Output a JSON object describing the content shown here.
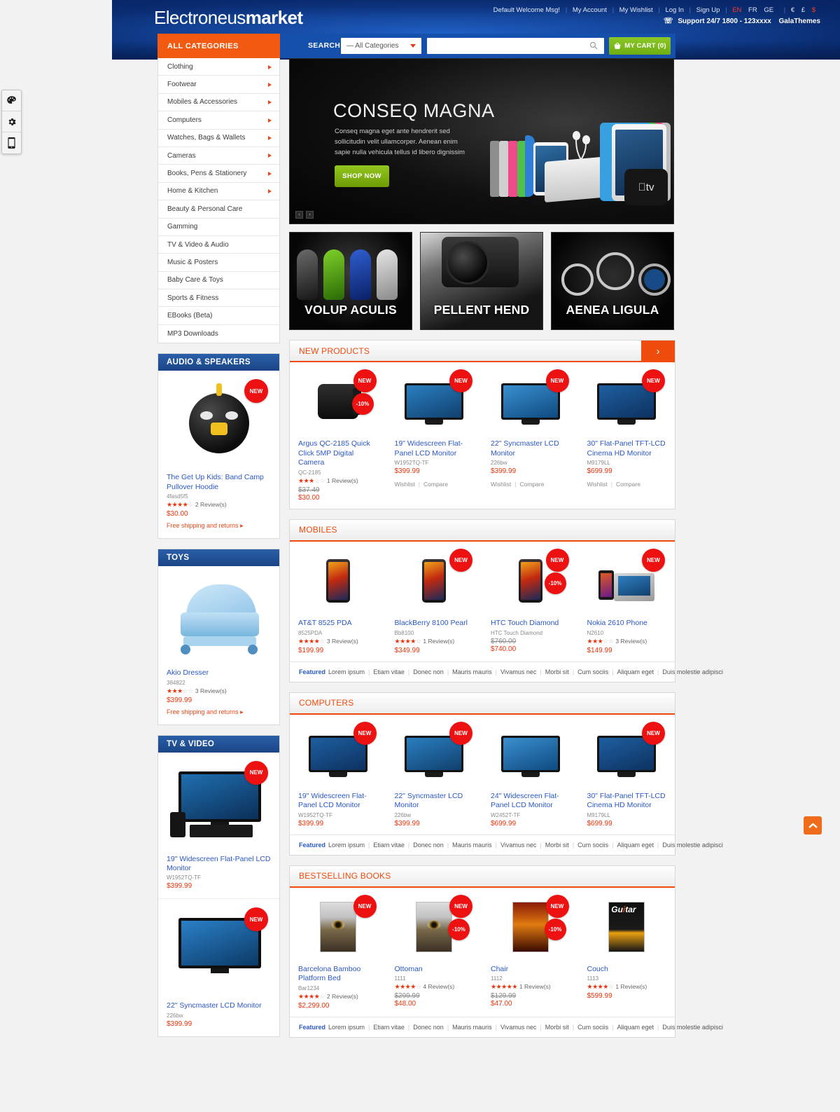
{
  "header": {
    "logo_light": "Electroneus",
    "logo_bold": "market",
    "toplinks": [
      "Default Welcome Msg!",
      "My Account",
      "My Wishlist",
      "Log In",
      "Sign Up"
    ],
    "languages": [
      "EN",
      "FR",
      "GE"
    ],
    "active_language": "EN",
    "currencies": [
      "€",
      "£",
      "$"
    ],
    "active_currency": "$",
    "support": "Support 24/7 1800 - 123xxxx",
    "brand": "GalaThemes",
    "phone_icon": "phone-icon"
  },
  "search": {
    "all_categories_tab": "ALL CATEGORIES",
    "label": "SEARCH:",
    "category_value": "— All Categories",
    "input_value": "",
    "placeholder": "",
    "cart_label": "MY CART (0)",
    "cart_count": 0
  },
  "categories": [
    {
      "label": "Clothing",
      "has_arrow": true
    },
    {
      "label": "Footwear",
      "has_arrow": true
    },
    {
      "label": "Mobiles & Accessories",
      "has_arrow": true
    },
    {
      "label": "Computers",
      "has_arrow": true
    },
    {
      "label": "Watches, Bags & Wallets",
      "has_arrow": true
    },
    {
      "label": "Cameras",
      "has_arrow": true
    },
    {
      "label": "Books, Pens & Stationery",
      "has_arrow": true
    },
    {
      "label": "Home & Kitchen",
      "has_arrow": true
    },
    {
      "label": "Beauty & Personal Care",
      "has_arrow": false
    },
    {
      "label": "Gamming",
      "has_arrow": false
    },
    {
      "label": "TV & Video & Audio",
      "has_arrow": false
    },
    {
      "label": "Music & Posters",
      "has_arrow": false
    },
    {
      "label": "Baby Care & Toys",
      "has_arrow": false
    },
    {
      "label": "Sports & Fitness",
      "has_arrow": false
    },
    {
      "label": "EBooks (Beta)",
      "has_arrow": false
    },
    {
      "label": "MP3 Downloads",
      "has_arrow": false
    }
  ],
  "hero": {
    "title": "CONSEQ MAGNA",
    "desc": "Conseq magna eget ante hendrerit sed sollicitudin velit ullamcorper. Aenean enim sapie nulla vehicula tellus id libero dignissim",
    "button": "SHOP NOW",
    "prev": "‹",
    "next": "›"
  },
  "promos": [
    {
      "label": "VOLUP ACULIS"
    },
    {
      "label": "PELLENT HEND"
    },
    {
      "label": "AENEA LIGULA"
    }
  ],
  "sidebar_widgets": [
    {
      "title": "AUDIO & SPEAKERS",
      "products": [
        {
          "name": "The Get Up Kids: Band Camp Pullover Hoodie",
          "sku": "4fasd5f5",
          "rating": 3.5,
          "reviews": "2 Review(s)",
          "price": "$30.00",
          "old_price": "",
          "badge_new": "NEW",
          "badge_off": "",
          "free_shipping": "Free shipping and returns"
        }
      ]
    },
    {
      "title": "TOYS",
      "products": [
        {
          "name": "Akio Dresser",
          "sku": "384822",
          "rating": 3,
          "reviews": "3 Review(s)",
          "price": "$399.99",
          "old_price": "",
          "badge_new": "",
          "badge_off": "",
          "free_shipping": "Free shipping and returns"
        }
      ]
    },
    {
      "title": "TV & VIDEO",
      "products": [
        {
          "name": "19\" Widescreen Flat-Panel LCD Monitor",
          "sku": "W1952TQ-TF",
          "rating": 0,
          "reviews": "",
          "price": "$399.99",
          "old_price": "",
          "badge_new": "NEW",
          "badge_off": "",
          "free_shipping": ""
        },
        {
          "name": "22\" Syncmaster LCD Monitor",
          "sku": "226bw",
          "rating": 0,
          "reviews": "",
          "price": "$399.99",
          "old_price": "",
          "badge_new": "NEW",
          "badge_off": "",
          "free_shipping": ""
        }
      ]
    }
  ],
  "sections": [
    {
      "title": "NEW PRODUCTS",
      "has_arrow": true,
      "arrow_glyph": "›",
      "footer": null,
      "products": [
        {
          "name": "Argus QC-2185 Quick Click 5MP Digital Camera",
          "sku": "QC-2185",
          "rating": 3,
          "reviews": "1 Review(s)",
          "old_price": "$37.49",
          "price": "$30.00",
          "badge_new": "NEW",
          "badge_off": "-10%",
          "wishlist": "",
          "compare": ""
        },
        {
          "name": "19\" Widescreen Flat-Panel LCD Monitor",
          "sku": "W1952TQ-TF",
          "rating": 0,
          "reviews": "",
          "old_price": "",
          "price": "$399.99",
          "badge_new": "NEW",
          "badge_off": "",
          "wishlist": "Wishlist",
          "compare": "Compare"
        },
        {
          "name": "22\" Syncmaster LCD Monitor",
          "sku": "226bw",
          "rating": 0,
          "reviews": "",
          "old_price": "",
          "price": "$399.99",
          "badge_new": "NEW",
          "badge_off": "",
          "wishlist": "Wishlist",
          "compare": "Compare"
        },
        {
          "name": "30\" Flat-Panel TFT-LCD Cinema HD Monitor",
          "sku": "M9179LL",
          "rating": 0,
          "reviews": "",
          "old_price": "",
          "price": "$699.99",
          "badge_new": "NEW",
          "badge_off": "",
          "wishlist": "Wishlist",
          "compare": "Compare"
        }
      ]
    },
    {
      "title": "MOBILES",
      "has_arrow": false,
      "arrow_glyph": "",
      "footer": {
        "active": "Featured",
        "items": [
          "Lorem ipsum",
          "Etiam vitae",
          "Donec non",
          "Mauris mauris",
          "Vivamus nec",
          "Morbi sit",
          "Cum sociis",
          "Aliquam eget",
          "Duis molestie adipisci"
        ]
      },
      "products": [
        {
          "name": "AT&T 8525 PDA",
          "sku": "8525PDA",
          "rating": 3.5,
          "reviews": "3 Review(s)",
          "old_price": "",
          "price": "$199.99",
          "badge_new": "",
          "badge_off": "",
          "wishlist": "",
          "compare": ""
        },
        {
          "name": "BlackBerry 8100 Pearl",
          "sku": "Bb8100",
          "rating": 3.5,
          "reviews": "1 Review(s)",
          "old_price": "",
          "price": "$349.99",
          "badge_new": "NEW",
          "badge_off": "",
          "wishlist": "",
          "compare": ""
        },
        {
          "name": "HTC Touch Diamond",
          "sku": "HTC Touch Diamond",
          "rating": 0,
          "reviews": "",
          "old_price": "$760.00",
          "price": "$740.00",
          "badge_new": "NEW",
          "badge_off": "-10%",
          "wishlist": "",
          "compare": ""
        },
        {
          "name": "Nokia 2610 Phone",
          "sku": "N2610",
          "rating": 2.5,
          "reviews": "3 Review(s)",
          "old_price": "",
          "price": "$149.99",
          "badge_new": "NEW",
          "badge_off": "",
          "wishlist": "",
          "compare": ""
        }
      ]
    },
    {
      "title": "COMPUTERS",
      "has_arrow": false,
      "arrow_glyph": "",
      "footer": {
        "active": "Featured",
        "items": [
          "Lorem ipsum",
          "Etiam vitae",
          "Donec non",
          "Mauris mauris",
          "Vivamus nec",
          "Morbi sit",
          "Cum sociis",
          "Aliquam eget",
          "Duis molestie adipisci"
        ]
      },
      "products": [
        {
          "name": "19\" Widescreen Flat-Panel LCD Monitor",
          "sku": "W1952TQ-TF",
          "rating": 0,
          "reviews": "",
          "old_price": "",
          "price": "$399.99",
          "badge_new": "NEW",
          "badge_off": "",
          "wishlist": "",
          "compare": ""
        },
        {
          "name": "22\" Syncmaster LCD Monitor",
          "sku": "226bw",
          "rating": 0,
          "reviews": "",
          "old_price": "",
          "price": "$399.99",
          "badge_new": "NEW",
          "badge_off": "",
          "wishlist": "",
          "compare": ""
        },
        {
          "name": "24\" Widescreen Flat-Panel LCD Monitor",
          "sku": "W2452T-TF",
          "rating": 0,
          "reviews": "",
          "old_price": "",
          "price": "$699.99",
          "badge_new": "",
          "badge_off": "",
          "wishlist": "",
          "compare": ""
        },
        {
          "name": "30\" Flat-Panel TFT-LCD Cinema HD Monitor",
          "sku": "M9179LL",
          "rating": 0,
          "reviews": "",
          "old_price": "",
          "price": "$699.99",
          "badge_new": "NEW",
          "badge_off": "",
          "wishlist": "",
          "compare": ""
        }
      ]
    },
    {
      "title": "BESTSELLING BOOKS",
      "has_arrow": false,
      "arrow_glyph": "",
      "footer": {
        "active": "Featured",
        "items": [
          "Lorem ipsum",
          "Etiam vitae",
          "Donec non",
          "Mauris mauris",
          "Vivamus nec",
          "Morbi sit",
          "Cum sociis",
          "Aliquam eget",
          "Duis molestie adipisci"
        ]
      },
      "products": [
        {
          "name": "Barcelona Bamboo Platform Bed",
          "sku": "Bar1234",
          "rating": 4,
          "reviews": "2 Review(s)",
          "old_price": "",
          "price": "$2,299.00",
          "badge_new": "NEW",
          "badge_off": "",
          "wishlist": "",
          "compare": ""
        },
        {
          "name": "Ottoman",
          "sku": "1111",
          "rating": 3.5,
          "reviews": "4 Review(s)",
          "old_price": "$299.99",
          "price": "$48.00",
          "badge_new": "NEW",
          "badge_off": "-10%",
          "wishlist": "",
          "compare": ""
        },
        {
          "name": "Chair",
          "sku": "1112",
          "rating": 5,
          "reviews": "1 Review(s)",
          "old_price": "$129.99",
          "price": "$47.00",
          "badge_new": "NEW",
          "badge_off": "-10%",
          "wishlist": "",
          "compare": ""
        },
        {
          "name": "Couch",
          "sku": "1113",
          "rating": 3.5,
          "reviews": "1 Review(s)",
          "old_price": "",
          "price": "$599.99",
          "badge_new": "",
          "badge_off": "",
          "wishlist": "",
          "compare": ""
        }
      ]
    }
  ],
  "toolbar": {
    "items": [
      "palette-icon",
      "gear-icon",
      "mobile-icon"
    ]
  },
  "scroll_top": {
    "glyph": "▲"
  },
  "colors": {
    "orange": "#ef4b0c",
    "blue": "#1b4586",
    "link_blue": "#2a57c6",
    "price_red": "#e8340c",
    "green": "#7fb81a"
  }
}
